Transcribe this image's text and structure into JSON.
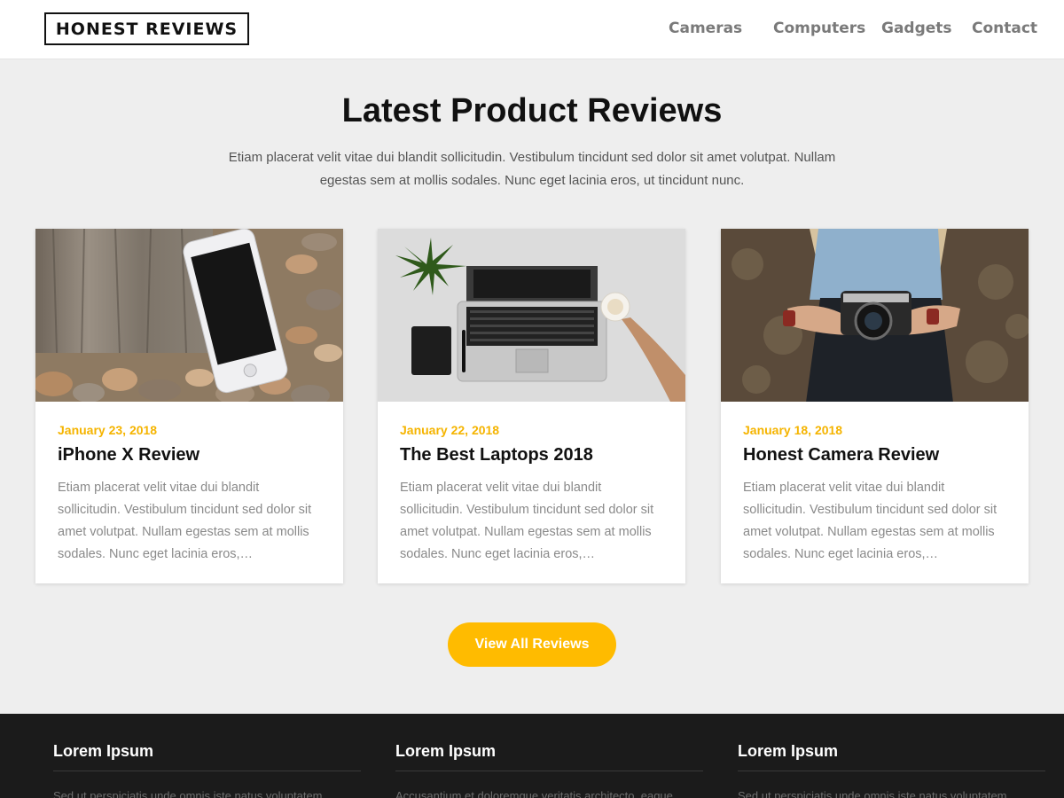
{
  "header": {
    "logo": "HONEST REVIEWS",
    "nav": [
      "Cameras",
      "Computers",
      "Gadgets",
      "Contact"
    ]
  },
  "intro": {
    "title": "Latest Product Reviews",
    "text": "Etiam placerat velit vitae dui blandit sollicitudin. Vestibulum tincidunt sed dolor sit amet volutpat. Nullam egestas sem at mollis sodales. Nunc eget lacinia eros, ut tincidunt nunc."
  },
  "cards": [
    {
      "image": "phone-on-stones-photo",
      "date": "January 23, 2018",
      "title": "iPhone X Review",
      "excerpt": "Etiam placerat velit vitae dui blandit sollicitudin. Vestibulum tincidunt sed dolor sit amet volutpat. Nullam egestas sem at mollis sodales. Nunc eget lacinia eros,…"
    },
    {
      "image": "laptop-desk-photo",
      "date": "January 22, 2018",
      "title": "The Best Laptops 2018",
      "excerpt": "Etiam placerat velit vitae dui blandit sollicitudin. Vestibulum tincidunt sed dolor sit amet volutpat. Nullam egestas sem at mollis sodales. Nunc eget lacinia eros,…"
    },
    {
      "image": "woman-with-camera-photo",
      "date": "January 18, 2018",
      "title": "Honest Camera Review",
      "excerpt": "Etiam placerat velit vitae dui blandit sollicitudin. Vestibulum tincidunt sed dolor sit amet volutpat. Nullam egestas sem at mollis sodales. Nunc eget lacinia eros,…"
    }
  ],
  "cta": {
    "label": "View All Reviews"
  },
  "footer": {
    "columns": [
      {
        "title": "Lorem Ipsum",
        "text": "Sed ut perspiciatis unde omnis iste natus voluptatem"
      },
      {
        "title": "Lorem Ipsum",
        "text": "Accusantium et doloremque veritatis architecto, eaque"
      },
      {
        "title": "Lorem Ipsum",
        "text": "Sed ut perspiciatis unde omnis iste natus voluptatem"
      }
    ]
  },
  "colors": {
    "accent": "#ffbb00",
    "date": "#f5b400",
    "footer_bg": "#1b1b1b",
    "page_bg": "#eeeeee"
  }
}
